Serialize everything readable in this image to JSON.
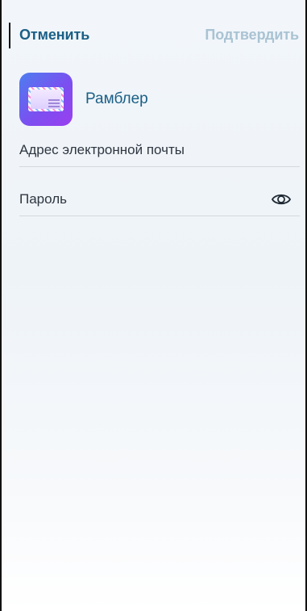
{
  "header": {
    "cancel_label": "Отменить",
    "confirm_label": "Подтвердить"
  },
  "account": {
    "name": "Рамблер",
    "icon": "mail-envelope-icon"
  },
  "form": {
    "email": {
      "placeholder": "Адрес электронной почты",
      "value": ""
    },
    "password": {
      "placeholder": "Пароль",
      "value": "",
      "toggle_icon": "eye-icon"
    }
  },
  "colors": {
    "accent": "#1a5f86",
    "disabled_action": "#a9c3d3",
    "app_icon_gradient": [
      "#4d7ef0",
      "#9a3ff0"
    ]
  }
}
